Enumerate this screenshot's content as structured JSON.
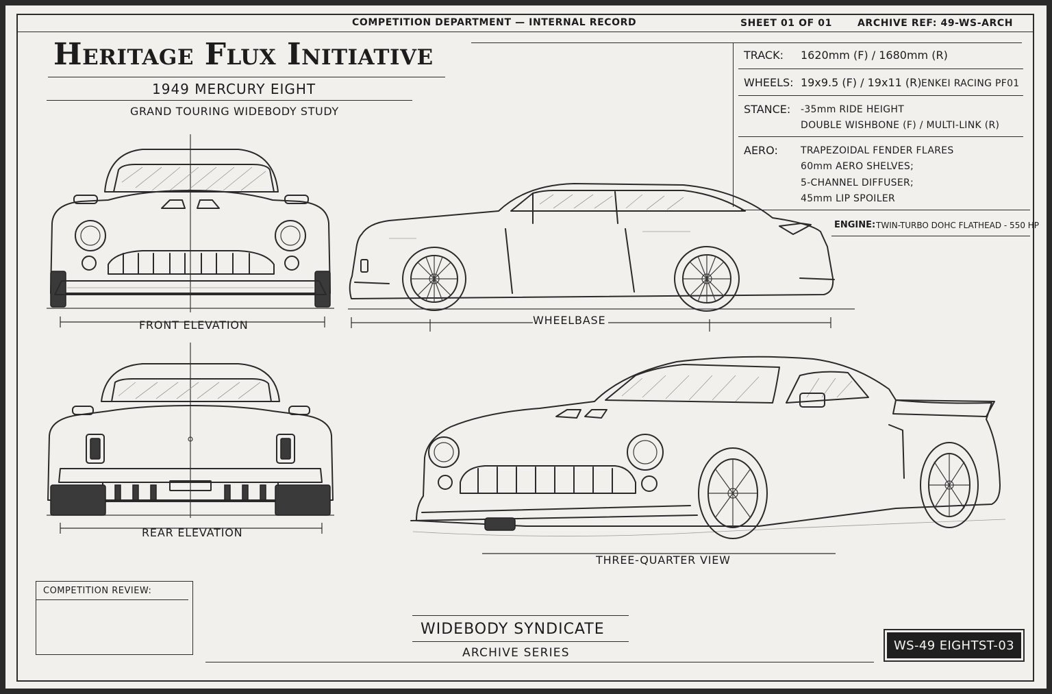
{
  "header": {
    "department": "COMPETITION DEPARTMENT — INTERNAL RECORD",
    "sheet": "SHEET 01 OF 01",
    "archive_ref": "ARCHIVE REF: 49-WS-ARCH"
  },
  "title": {
    "main": "Heritage Flux Initiative",
    "model": "1949 MERCURY EIGHT",
    "study": "GRAND TOURING WIDEBODY STUDY"
  },
  "specs": {
    "track_label": "TRACK:",
    "track_value": "1620mm (F) / 1680mm (R)",
    "wheels_label": "WHEELS:",
    "wheels_value": "19x9.5 (F) / 19x11 (R)",
    "wheels_brand": "ENKEI RACING PF01",
    "stance_label": "STANCE:",
    "stance_line1": "-35mm RIDE HEIGHT",
    "stance_line2": "DOUBLE WISHBONE (F) / MULTI-LINK (R)",
    "aero_label": "AERO:",
    "aero_line1": "TRAPEZOIDAL FENDER FLARES",
    "aero_line2": "60mm AERO SHELVES;",
    "aero_line3": "5-CHANNEL DIFFUSER;",
    "aero_line4": "45mm LIP SPOILER",
    "engine_label": "ENGINE:",
    "engine_value": "TWIN-TURBO DOHC FLATHEAD - 550 HP"
  },
  "views": {
    "front": "FRONT ELEVATION",
    "wheelbase": "WHEELBASE",
    "rear": "REAR ELEVATION",
    "three_quarter": "THREE-QUARTER VIEW"
  },
  "review": {
    "label": "COMPETITION REVIEW:"
  },
  "footer": {
    "brand": "WIDEBODY SYNDICATE",
    "series": "ARCHIVE SERIES",
    "code": "WS-49 EIGHTST-03"
  }
}
